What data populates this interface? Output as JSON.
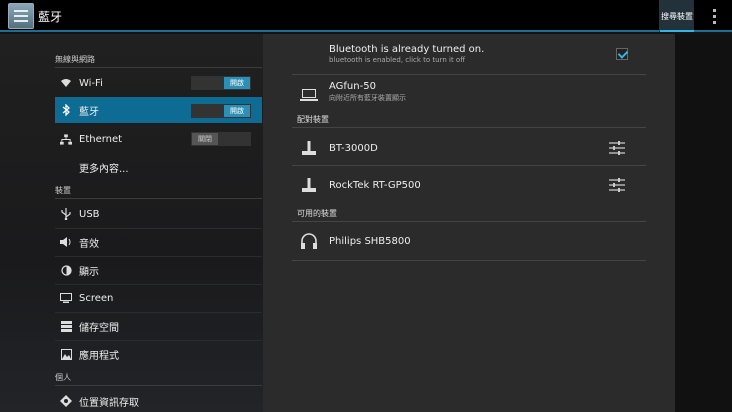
{
  "header": {
    "title": "藍牙",
    "search_button": "搜尋裝置"
  },
  "sidebar": {
    "sections": [
      "無線與網路",
      "裝置",
      "個人"
    ],
    "items": [
      {
        "label": "Wi-Fi",
        "icon": "wifi-icon",
        "toggle": "開啟",
        "toggle_on": true
      },
      {
        "label": "藍牙",
        "icon": "bluetooth-icon",
        "toggle": "開啟",
        "toggle_on": true,
        "selected": true
      },
      {
        "label": "Ethernet",
        "icon": "ethernet-icon",
        "toggle": "關閉",
        "toggle_on": false
      },
      {
        "label": "更多內容..."
      },
      {
        "label": "USB",
        "icon": "usb-icon"
      },
      {
        "label": "音效",
        "icon": "speaker-icon"
      },
      {
        "label": "顯示",
        "icon": "display-icon"
      },
      {
        "label": "Screen",
        "icon": "screen-icon"
      },
      {
        "label": "儲存空間",
        "icon": "storage-icon"
      },
      {
        "label": "應用程式",
        "icon": "apps-icon"
      },
      {
        "label": "位置資訊存取",
        "icon": "location-icon"
      }
    ]
  },
  "main": {
    "bt_status_title": "Bluetooth is already turned on.",
    "bt_status_sub": "bluetooth is enabled, click to turn it off",
    "bt_checked": true,
    "this_device": {
      "name": "AGfun-50",
      "sub": "向附近所有藍牙裝置顯示"
    },
    "paired_header": "配對裝置",
    "paired": [
      {
        "name": "BT-3000D"
      },
      {
        "name": "RockTek RT-GP500"
      }
    ],
    "available_header": "可用的裝置",
    "available": [
      {
        "name": "Philips SHB5800"
      }
    ]
  },
  "colors": {
    "accent": "#33b5e5",
    "selected": "#0e6b94"
  }
}
